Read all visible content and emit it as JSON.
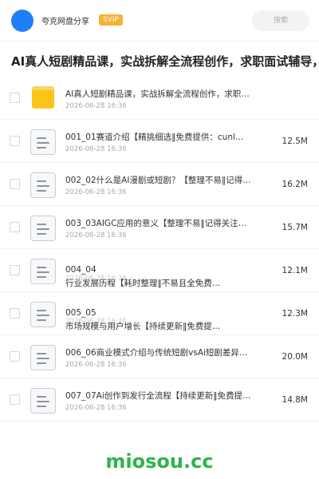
{
  "header": {
    "share_name": "夸克网盘分享",
    "badge": "SVIP",
    "search_placeholder": "搜索",
    "accent_color": "#1e80f6",
    "badge_color": "#f7b031"
  },
  "title": "AI真人短剧精品课，实战拆解全流程创作，求职面试辅导，",
  "items": [
    {
      "icon": "folder-icon",
      "name": "AI真人短剧精品课，实战拆解全流程创作，求职面试辅…",
      "name2": "",
      "date": "2026-06-28 16:36",
      "size": ""
    },
    {
      "icon": "document-icon",
      "name": "001_01赛道介绍【精挑细选‖免费提供：cunl…",
      "name2": "",
      "date": "2026-06-28 16:36",
      "size": "12.5M"
    },
    {
      "icon": "document-icon",
      "name": "002_02什么是AI漫剧或短剧？【整理不易‖记得…",
      "name2": "",
      "date": "2026-06-28 16:36",
      "size": "16.2M"
    },
    {
      "icon": "document-icon",
      "name": "003_03AIGC应用的意义【整理不易‖记得关注…",
      "name2": "",
      "date": "2026-06-28 16:36",
      "size": "15.7M"
    },
    {
      "icon": "document-icon",
      "name": "004_04",
      "name2": "行业发展历程【耗时整理‖不易且全免费…",
      "date": "2026-06-28 16:36",
      "size": "12.1M"
    },
    {
      "icon": "document-icon",
      "name": "005_05",
      "name2": "市场规模与用户增长【持续更新‖免费提…",
      "date": "2026-06-28 16:36",
      "size": "12.3M"
    },
    {
      "icon": "document-icon",
      "name": "006_06商业模式介绍与传统短剧vsAi短剧差异…",
      "name2": "",
      "date": "2026-06-28 16:36",
      "size": "20.0M"
    },
    {
      "icon": "document-icon",
      "name": "007_07Ai创作到发行全流程【持续更新‖免费提…",
      "name2": "",
      "date": "2026-06-28 16:36",
      "size": "14.8M"
    }
  ],
  "watermark": "miosou.cc"
}
